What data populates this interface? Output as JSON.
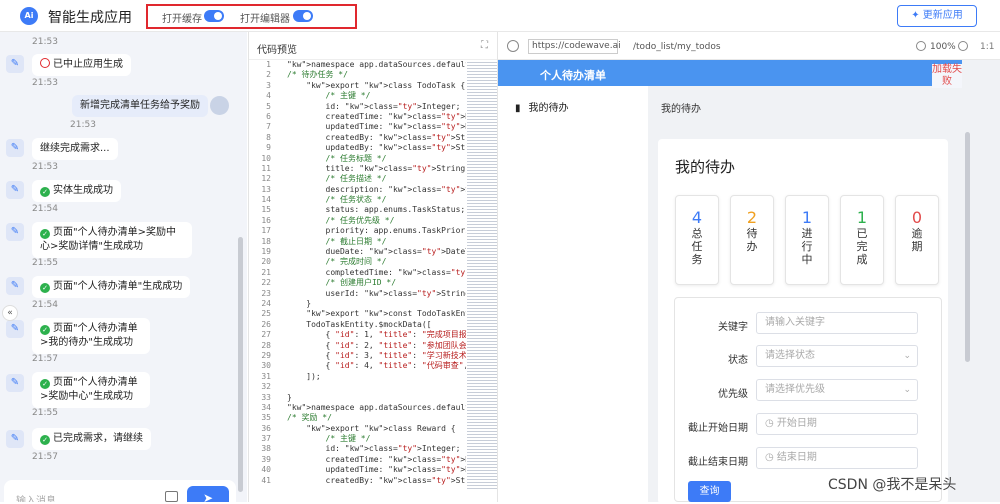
{
  "header": {
    "logo": "Ai",
    "title": "智能生成应用",
    "toggle_cache": "打开缓存",
    "toggle_editor": "打开编辑器",
    "update_button": "更新应用"
  },
  "chat": {
    "messages": [
      {
        "text": "21:53",
        "kind": "time"
      },
      {
        "text": "已中止应用生成",
        "status": "stopped",
        "time": "21:53"
      },
      {
        "text": "新增完成清单任务给予奖励",
        "kind": "user",
        "time": "21:53"
      },
      {
        "text": "继续完成需求...",
        "time": "21:53"
      },
      {
        "text": "实体生成成功",
        "status": "ok",
        "time": "21:54"
      },
      {
        "text": "页面\"个人待办清单>奖励中心>奖励详情\"生成成功",
        "status": "ok",
        "time": "21:55"
      },
      {
        "text": "页面\"个人待办清单\"生成成功",
        "status": "ok",
        "time": "21:54"
      },
      {
        "text": "页面\"个人待办清单>我的待办\"生成成功",
        "status": "ok",
        "time": "21:57"
      },
      {
        "text": "页面\"个人待办清单>奖励中心\"生成成功",
        "status": "ok",
        "time": "21:55"
      },
      {
        "text": "已完成需求，请继续",
        "status": "ok",
        "time": "21:57"
      }
    ],
    "input_placeholder": "输入消息..."
  },
  "code": {
    "title": "代码预览",
    "lines": [
      "namespace app.dataSources.defaultDS.ent",
      "/* 待办任务 */",
      "    export class TodoTask {",
      "        /* 主键 */",
      "        id: Integer;",
      "        createdTime: DateTime;",
      "        updatedTime: DateTime;",
      "        createdBy: String;",
      "        updatedBy: String;",
      "        /* 任务标题 */",
      "        title: String;",
      "        /* 任务描述 */",
      "        description: String;",
      "        /* 任务状态 */",
      "        status: app.enums.TaskStatus;",
      "        /* 任务优先级 */",
      "        priority: app.enums.TaskPriorit",
      "        /* 截止日期 */",
      "        dueDate: DateTime;",
      "        /* 完成时间 */",
      "        completedTime: DateTime;",
      "        /* 创建用户ID */",
      "        userId: String;",
      "    }",
      "    export const TodoTaskEntity = creat",
      "    TodoTaskEntity.$mockData([",
      "        { \"id\": 1, \"title\": \"完成项目报",
      "        { \"id\": 2, \"title\": \"参加团队会",
      "        { \"id\": 3, \"title\": \"学习新技术",
      "        { \"id\": 4, \"title\": \"代码审查\",",
      "    ]);",
      "",
      "}",
      "namespace app.dataSources.defaultDS.ent",
      "/* 奖励 */",
      "    export class Reward {",
      "        /* 主键 */",
      "        id: Integer;",
      "        createdTime: DateTime;",
      "        updatedTime: DateTime;",
      "        createdBy: String;"
    ]
  },
  "preview": {
    "url_host": "https://codewave.ai",
    "url_path": "/todo_list/my_todos",
    "zoom": "100%",
    "ratio": "1:1",
    "app_title": "个人待办清单",
    "load_failed": "加载失败",
    "nav_item": "我的待办",
    "breadcrumb": "我的待办",
    "card_title": "我的待办",
    "stats": [
      {
        "num": "4",
        "label": "总任务",
        "color": "#3d7bf7"
      },
      {
        "num": "2",
        "label": "待办",
        "color": "#f0a020"
      },
      {
        "num": "1",
        "label": "进行中",
        "color": "#3d7bf7"
      },
      {
        "num": "1",
        "label": "已完成",
        "color": "#2db14d"
      },
      {
        "num": "0",
        "label": "逾期",
        "color": "#e24b4b"
      }
    ],
    "form": {
      "keyword_label": "关键字",
      "keyword_ph": "请输入关键字",
      "status_label": "状态",
      "status_ph": "请选择状态",
      "priority_label": "优先级",
      "priority_ph": "请选择优先级",
      "start_label": "截止开始日期",
      "start_ph": "开始日期",
      "end_label": "截止结束日期",
      "end_ph": "结束日期",
      "query_button": "查询"
    }
  },
  "watermark": "CSDN @我不是呆头"
}
